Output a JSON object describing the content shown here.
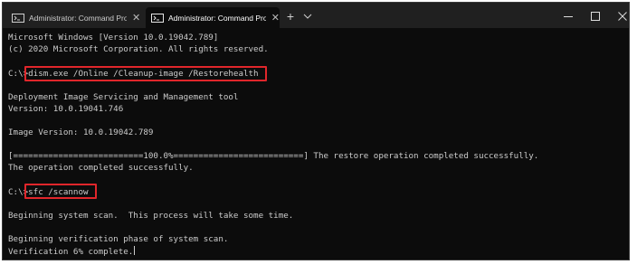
{
  "window": {
    "tabs": [
      {
        "title": "Administrator: Command Promp",
        "close": "✕",
        "icon": "terminal-icon"
      },
      {
        "title": "Administrator: Command Promp",
        "close": "✕",
        "icon": "terminal-icon"
      }
    ],
    "new_tab": "+",
    "dropdown": "chevron-down-icon",
    "controls": [
      "minimize-icon",
      "maximize-icon",
      "close-icon"
    ]
  },
  "console": {
    "lines": [
      "Microsoft Windows [Version 10.0.19042.789]",
      "(c) 2020 Microsoft Corporation. All rights reserved.",
      "C:\\>",
      "dism.exe /Online /Cleanup-image /Restorehealth",
      "Deployment Image Servicing and Management tool",
      "Version: 10.0.19041.746",
      "Image Version: 10.0.19042.789",
      "[==========================100.0%==========================] The restore operation completed successfully.",
      "The operation completed successfully.",
      "C:\\>",
      "sfc /scannow",
      "Beginning system scan.  This process will take some time.",
      "Beginning verification phase of system scan.",
      "Verification 6% complete."
    ]
  },
  "colors": {
    "background": "#0c0c0c",
    "text": "#cccccc",
    "titlebar": "#202020",
    "highlight": "#e0262b"
  }
}
